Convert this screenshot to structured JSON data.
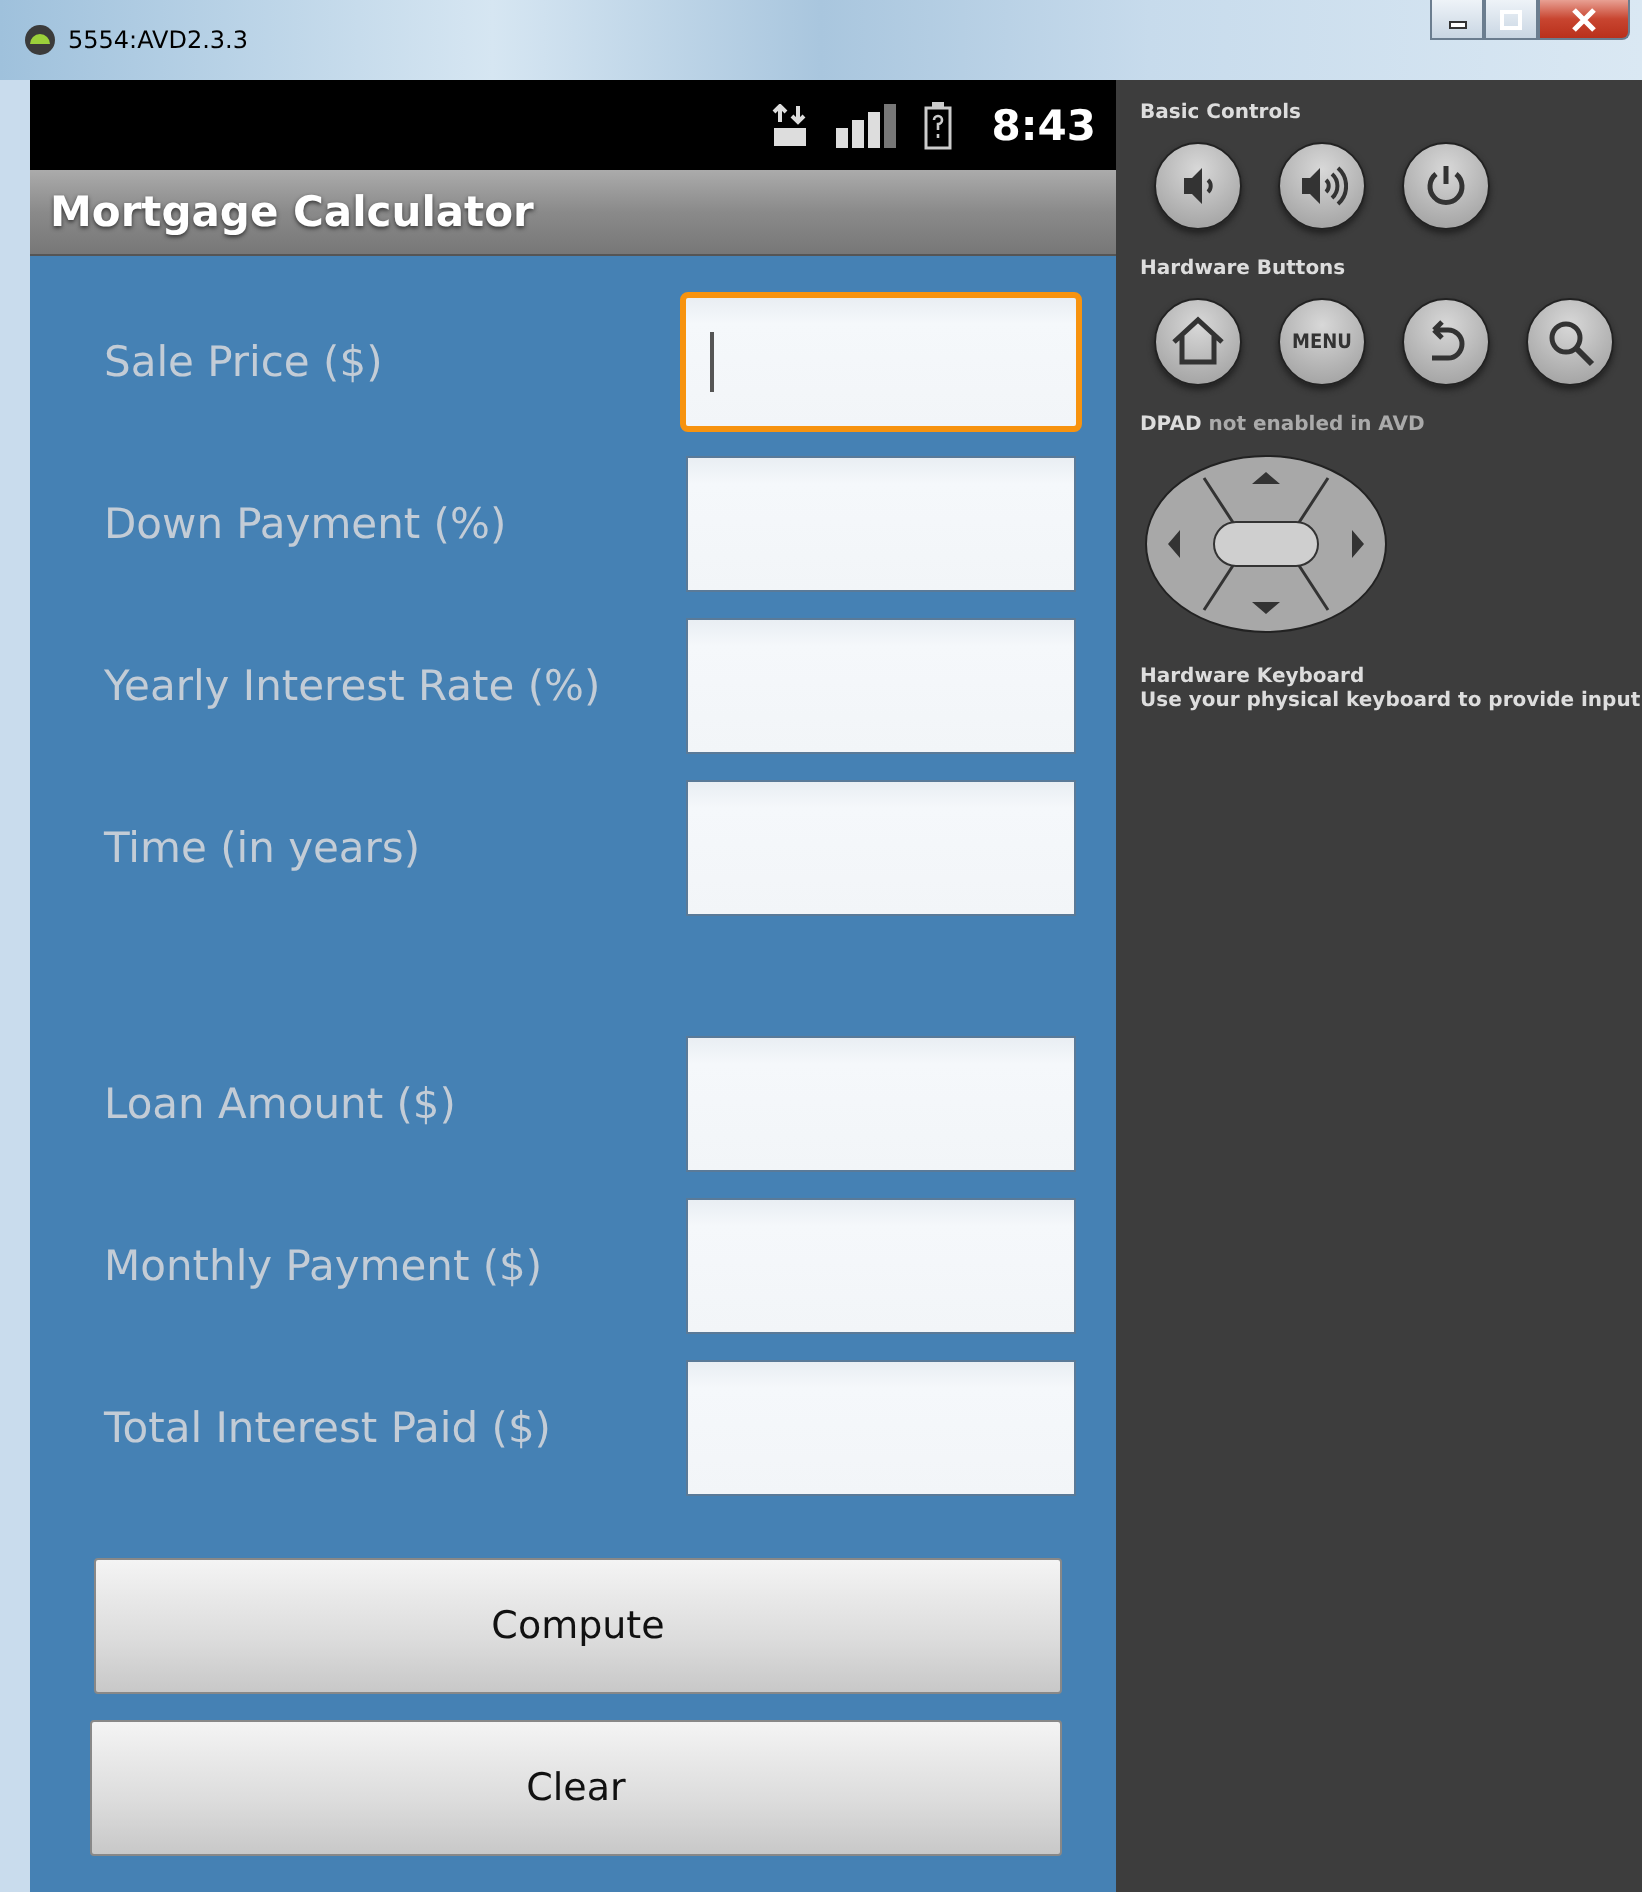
{
  "window": {
    "title": "5554:AVD2.3.3"
  },
  "status_bar": {
    "time": "8:43"
  },
  "app": {
    "title": "Mortgage Calculator",
    "inputs": [
      {
        "label": "Sale Price ($)",
        "focused": true
      },
      {
        "label": "Down Payment (%)",
        "focused": false
      },
      {
        "label": "Yearly Interest Rate (%)",
        "focused": false
      },
      {
        "label": "Time (in years)",
        "focused": false
      }
    ],
    "outputs": [
      {
        "label": "Loan Amount ($)"
      },
      {
        "label": "Monthly Payment ($)"
      },
      {
        "label": "Total Interest Paid ($)"
      }
    ],
    "buttons": [
      "Compute",
      "Clear"
    ]
  },
  "controls": {
    "basic_controls": {
      "heading": "Basic Controls",
      "buttons": [
        {
          "kind": "volume-down"
        },
        {
          "kind": "volume-up"
        },
        {
          "kind": "power"
        }
      ]
    },
    "hardware_buttons": {
      "heading": "Hardware Buttons",
      "buttons": [
        {
          "kind": "home"
        },
        {
          "kind": "menu",
          "label": "MENU"
        },
        {
          "kind": "back"
        },
        {
          "kind": "search"
        }
      ]
    },
    "dpad": {
      "heading": "DPAD",
      "note": "not enabled in AVD"
    },
    "keyboard": {
      "heading": "Hardware Keyboard",
      "note": "Use your physical keyboard to provide input"
    }
  }
}
